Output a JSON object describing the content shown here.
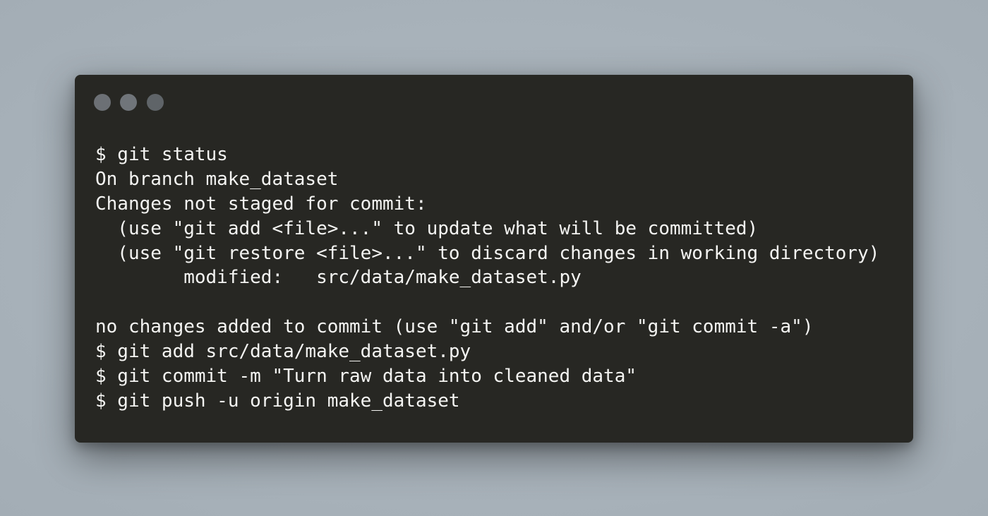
{
  "terminal": {
    "window_controls": [
      "close-dot",
      "minimize-dot",
      "zoom-dot"
    ],
    "lines": [
      "$ git status",
      "On branch make_dataset",
      "Changes not staged for commit:",
      "  (use \"git add <file>...\" to update what will be committed)",
      "  (use \"git restore <file>...\" to discard changes in working directory)",
      "        modified:   src/data/make_dataset.py",
      "",
      "no changes added to commit (use \"git add\" and/or \"git commit -a\")",
      "$ git add src/data/make_dataset.py",
      "$ git commit -m \"Turn raw data into cleaned data\"",
      "$ git push -u origin make_dataset"
    ]
  },
  "colors": {
    "background": "#a9b3bb",
    "window": "#272723",
    "text": "#f4f4f2",
    "dots": "#6b6f74"
  }
}
